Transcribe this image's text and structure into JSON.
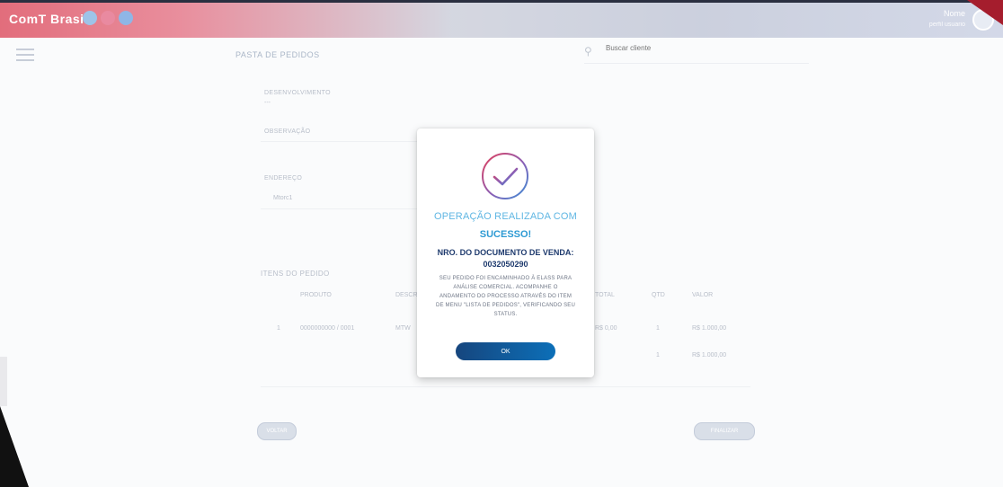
{
  "header": {
    "logo_text": "ComT Brasil",
    "user_name": "Nome",
    "user_subtitle": "perfil usuario",
    "colors": {
      "accent_red": "#d9364a",
      "brand_blue": "#16467e"
    }
  },
  "subheader": {
    "page_title": "PASTA DE PEDIDOS",
    "search_placeholder": "Buscar cliente"
  },
  "form": {
    "field1_label": "DESENVOLVIMENTO",
    "field1_value": "---",
    "field2_label": "OBSERVAÇÃO",
    "field3_label": "ENDEREÇO",
    "field3_value": "Mtorc1",
    "table_title": "ITENS DO PEDIDO",
    "columns": [
      "PRODUTO",
      "DESCRIÇÃO",
      "TOTAL",
      "QTD",
      "VALOR"
    ],
    "rows": [
      {
        "index": "1",
        "code": "0000000000 / 0001",
        "desc": "MTW",
        "total": "R$ 0,00",
        "qty": "1",
        "value": "R$ 1.000,00"
      },
      {
        "qty": "1",
        "value": "R$ 1.000,00"
      }
    ],
    "back_label": "VOLTAR",
    "finish_label": "FINALIZAR"
  },
  "modal": {
    "title": "OPERAÇÃO REALIZADA COM",
    "success": "SUCESSO!",
    "doc_label": "NRO. DO DOCUMENTO DE VENDA:",
    "doc_number": "0032050290",
    "message": "SEU PEDIDO FOI ENCAMINHADO À ELASS PARA ANÁLISE COMERCIAL. ACOMPANHE O ANDAMENTO DO PROCESSO ATRAVÉS DO ITEM DE MENU \"LISTA DE PEDIDOS\", VERIFICANDO SEU STATUS.",
    "ok_label": "OK",
    "icon": "check-circle-icon"
  }
}
